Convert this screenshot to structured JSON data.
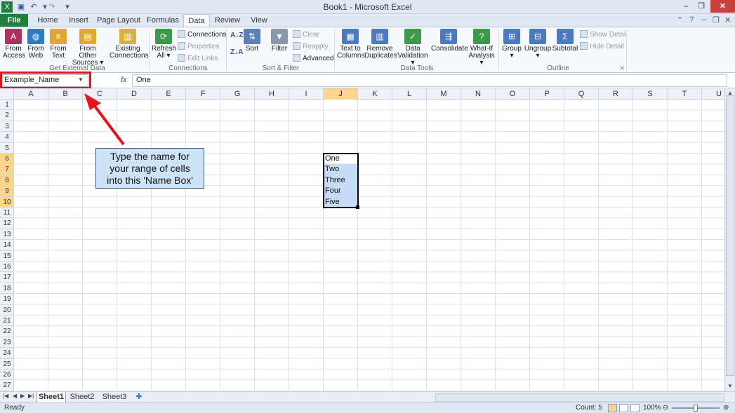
{
  "window": {
    "title": "Book1 - Microsoft Excel",
    "min": "–",
    "restore": "❐",
    "close": "✕"
  },
  "tabs": [
    "File",
    "Home",
    "Insert",
    "Page Layout",
    "Formulas",
    "Data",
    "Review",
    "View"
  ],
  "ribbon": {
    "get_external": {
      "label": "Get External Data",
      "from_access": [
        "From",
        "Access"
      ],
      "from_web": [
        "From",
        "Web"
      ],
      "from_text": [
        "From",
        "Text"
      ],
      "from_other": [
        "From Other",
        "Sources ▾"
      ],
      "existing": [
        "Existing",
        "Connections"
      ]
    },
    "connections": {
      "label": "Connections",
      "refresh": [
        "Refresh",
        "All ▾"
      ],
      "connections": "Connections",
      "properties": "Properties",
      "edit_links": "Edit Links"
    },
    "sort_filter": {
      "label": "Sort & Filter",
      "sort": "Sort",
      "filter": "Filter",
      "clear": "Clear",
      "reapply": "Reapply",
      "advanced": "Advanced"
    },
    "data_tools": {
      "label": "Data Tools",
      "text_to_columns": [
        "Text to",
        "Columns"
      ],
      "remove_duplicates": [
        "Remove",
        "Duplicates"
      ],
      "data_validation": [
        "Data",
        "Validation ▾"
      ],
      "consolidate": "Consolidate",
      "what_if": [
        "What-If",
        "Analysis ▾"
      ]
    },
    "outline": {
      "label": "Outline",
      "group": [
        "Group",
        "▾"
      ],
      "ungroup": [
        "Ungroup",
        "▾"
      ],
      "subtotal": "Subtotal",
      "show_detail": "Show Detail",
      "hide_detail": "Hide Detail"
    }
  },
  "formula_bar": {
    "name_box": "Example_Name",
    "fx": "fx",
    "value": "One"
  },
  "columns": [
    "A",
    "B",
    "C",
    "D",
    "E",
    "F",
    "G",
    "H",
    "I",
    "J",
    "K",
    "L",
    "M",
    "N",
    "O",
    "P",
    "Q",
    "R",
    "S",
    "T",
    "U"
  ],
  "selected_column": "J",
  "rows": 27,
  "selected_rows": [
    6,
    7,
    8,
    9,
    10
  ],
  "cells": [
    {
      "ref": "J6",
      "value": "One"
    },
    {
      "ref": "J7",
      "value": "Two"
    },
    {
      "ref": "J8",
      "value": "Three"
    },
    {
      "ref": "J9",
      "value": "Four"
    },
    {
      "ref": "J10",
      "value": "Five"
    }
  ],
  "annotation": {
    "lines": [
      "Type the name for",
      "your range of cells",
      "into this 'Name Box'"
    ],
    "color": "#e8141b"
  },
  "sheets": [
    "Sheet1",
    "Sheet2",
    "Sheet3"
  ],
  "active_sheet": "Sheet1",
  "status": {
    "left": "Ready",
    "count": "Count: 5",
    "zoom": "100%"
  }
}
